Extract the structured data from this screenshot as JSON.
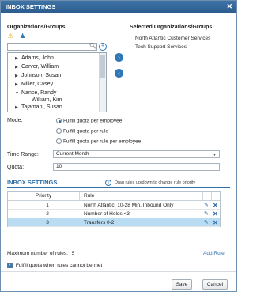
{
  "dialog": {
    "title": "INBOX SETTINGS",
    "close": "✕"
  },
  "org_panel": {
    "label": "Organizations/Groups",
    "icons": [
      "warning-icon",
      "user-group-icon"
    ],
    "search_placeholder": "",
    "tree_items": [
      {
        "label": "Adams, John",
        "has_children": true
      },
      {
        "label": "Carver, William",
        "has_children": true
      },
      {
        "label": "Johnson, Susan",
        "has_children": true
      },
      {
        "label": "Miller, Casey",
        "has_children": true
      },
      {
        "label": "Nance, Randy",
        "has_children": true
      },
      {
        "label": "William, Kim",
        "has_children": false
      },
      {
        "label": "Tajamani, Susan",
        "has_children": true
      }
    ]
  },
  "selected_panel": {
    "label": "Selected Organizations/Groups",
    "items": [
      "North Atlantic Customer Services",
      "Tech Support Services"
    ]
  },
  "transfer": {
    "add": "›",
    "remove": "‹"
  },
  "mode": {
    "label": "Mode:",
    "options": [
      {
        "label": "Fulfill quota per employee",
        "selected": true
      },
      {
        "label": "Fulfill quota per rule",
        "selected": false
      },
      {
        "label": "Fulfill quota per rule per employee",
        "selected": false
      }
    ]
  },
  "time_range": {
    "label": "Time Range:",
    "value": "Current Month"
  },
  "quota": {
    "label": "Quota:",
    "value": "10"
  },
  "inbox_settings": {
    "title": "INBOX SETTINGS",
    "hint": "Drag rules up/down to change rule priority",
    "columns": [
      "Priority",
      "Rule"
    ],
    "rules": [
      {
        "priority": "1",
        "rule": "North Atlantic, 10-28 Min, Inbound Only",
        "selected": false
      },
      {
        "priority": "2",
        "rule": "Number of Holds <3",
        "selected": false
      },
      {
        "priority": "3",
        "rule": "Transfers 0-2",
        "selected": true
      }
    ]
  },
  "max_rules": {
    "label": "Maximum number of rules:",
    "value": "5"
  },
  "add_rule": "Add Rule",
  "fulfill_checkbox": {
    "label": "Fulfill quota when rules cannot be met",
    "checked": true
  },
  "buttons": {
    "save": "Save",
    "cancel": "Cancel"
  },
  "colors": {
    "title_bar": "#2f6396",
    "accent": "#2f78b8",
    "selected_row": "#b9dcf2"
  }
}
